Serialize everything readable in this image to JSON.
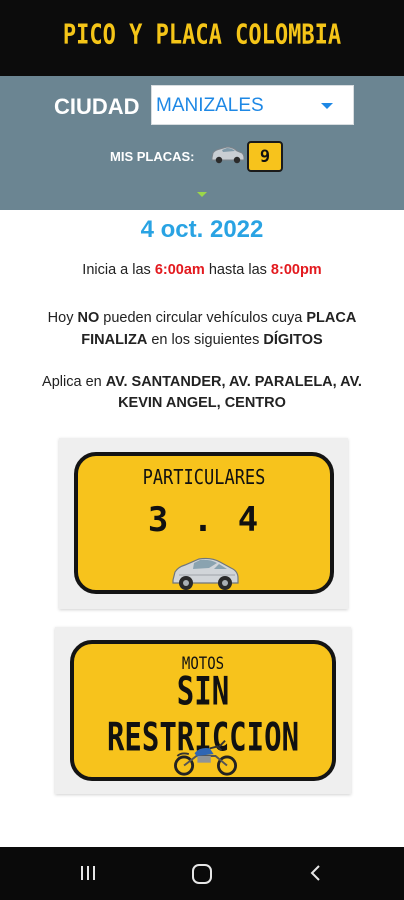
{
  "app": {
    "title": "PICO Y PLACA COLOMBIA"
  },
  "city": {
    "label": "CIUDAD",
    "selected": "MANIZALES"
  },
  "my_plates": {
    "label": "MIS PLACAS:",
    "value": "9"
  },
  "date": "4 oct. 2022",
  "hours": {
    "prefix": "Inicia a las ",
    "start": "6:00am",
    "middle": " hasta las ",
    "end": "8:00pm"
  },
  "notice": {
    "p1": "Hoy ",
    "no": "NO",
    "p2": " pueden circular vehículos cuya ",
    "placa": "PLACA",
    "finaliza": "FINALIZA",
    "p3": " en los siguientes ",
    "digitos": "DÍGITOS"
  },
  "applies": {
    "prefix": "Aplica en ",
    "places": "AV. SANTANDER, AV. PARALELA, AV. KEVIN ANGEL, CENTRO"
  },
  "cards": {
    "particulares": {
      "title": "PARTICULARES",
      "value": "3 . 4",
      "icon": "car-icon"
    },
    "motos": {
      "title": "MOTOS",
      "value": "SIN RESTRICCION",
      "icon": "motorcycle-icon"
    }
  },
  "colors": {
    "plate_yellow": "#f7c31c",
    "header_bg": "#0c0c0c",
    "panel_bg": "#6b8592",
    "accent_blue": "#29a3e3",
    "accent_red": "#e3191e"
  },
  "navbar": {
    "icons": [
      "recent-apps-icon",
      "home-icon",
      "back-icon"
    ]
  }
}
